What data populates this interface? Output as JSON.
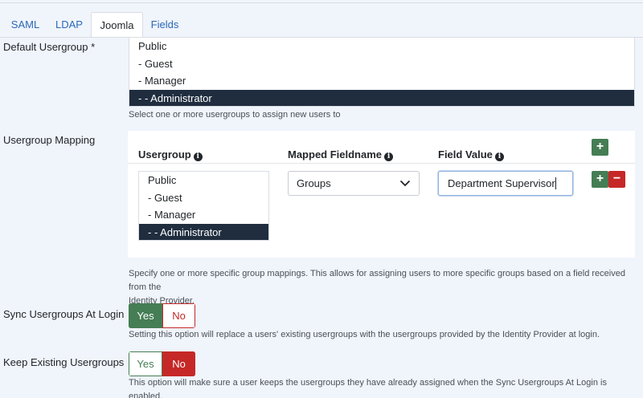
{
  "tabs": [
    {
      "label": "SAML"
    },
    {
      "label": "LDAP"
    },
    {
      "label": "Joomla"
    },
    {
      "label": "Fields"
    }
  ],
  "active_tab": "Joomla",
  "default_usergroup": {
    "label": "Default Usergroup *",
    "options": [
      "Public",
      "- Guest",
      "- Manager",
      "- - Administrator"
    ],
    "selected": "- - Administrator",
    "help": "Select one or more usergroups to assign new users to"
  },
  "usergroup_mapping": {
    "label": "Usergroup Mapping",
    "headers": {
      "usergroup": "Usergroup",
      "mapped_fieldname": "Mapped Fieldname",
      "field_value": "Field Value"
    },
    "row": {
      "usergroup_options": [
        "Public",
        "- Guest",
        "- Manager",
        "- - Administrator"
      ],
      "selected": "- - Administrator",
      "mapped_fieldname": "Groups",
      "field_value": "Department Supervisor"
    },
    "help_line1": "Specify one or more specific group mappings. This allows for assigning users to more specific groups based on a field received from the",
    "help_line2": "Identity Provider."
  },
  "sync_usergroups": {
    "label": "Sync Usergroups At Login",
    "yes": "Yes",
    "no": "No",
    "value": "Yes",
    "help": "Setting this option will replace a users' existing usergroups with the usergroups provided by the Identity Provider at login."
  },
  "keep_existing": {
    "label": "Keep Existing Usergroups",
    "yes": "Yes",
    "no": "No",
    "value": "No",
    "help": "This option will make sure a user keeps the usergroups they have already assigned when the Sync Usergroups At Login is enabled."
  },
  "colors": {
    "success": "#457d54",
    "danger": "#c52827",
    "selected_option": "#1f2d3f",
    "link": "#2a69b8"
  },
  "icons": {
    "info": "info-circle-icon",
    "add": "plus-icon",
    "remove": "minus-icon",
    "dropdown": "chevron-down-icon"
  }
}
